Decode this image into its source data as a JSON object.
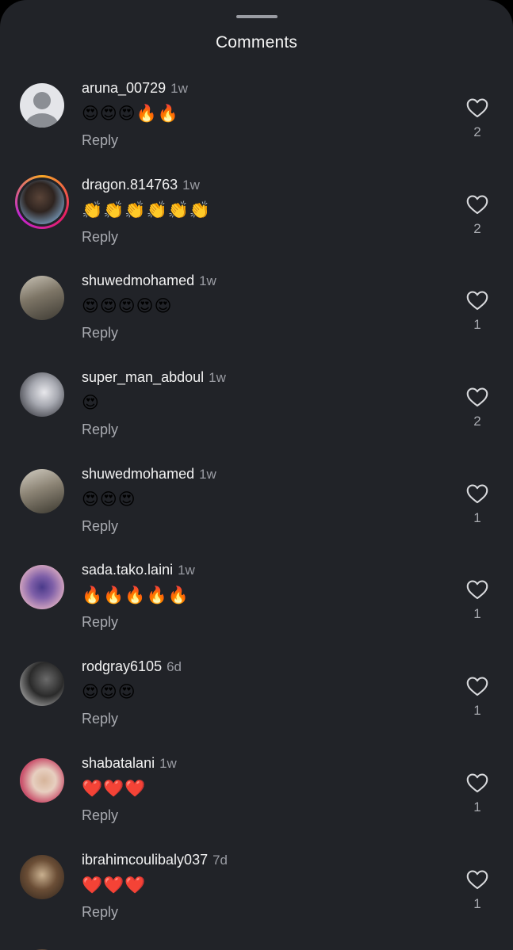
{
  "header": {
    "title": "Comments"
  },
  "comments": [
    {
      "username": "aruna_00729",
      "time": "1w",
      "text": "😍😍😍🔥🔥",
      "reply": "Reply",
      "likes": "2",
      "avatar": "default"
    },
    {
      "username": "dragon.814763",
      "time": "1w",
      "text": "👏👏👏👏👏👏",
      "reply": "Reply",
      "likes": "2",
      "avatar": "story"
    },
    {
      "username": "shuwedmohamed",
      "time": "1w",
      "text": "😍😍😍😍😍",
      "reply": "Reply",
      "likes": "1",
      "avatar": "photo"
    },
    {
      "username": "super_man_abdoul",
      "time": "1w",
      "text": "😍",
      "reply": "Reply",
      "likes": "2",
      "avatar": "photo"
    },
    {
      "username": "shuwedmohamed",
      "time": "1w",
      "text": "😍😍😍",
      "reply": "Reply",
      "likes": "1",
      "avatar": "photo"
    },
    {
      "username": "sada.tako.laini",
      "time": "1w",
      "text": "🔥🔥🔥🔥🔥",
      "reply": "Reply",
      "likes": "1",
      "avatar": "photo"
    },
    {
      "username": "rodgray6105",
      "time": "6d",
      "text": "😍😍😍",
      "reply": "Reply",
      "likes": "1",
      "avatar": "photo"
    },
    {
      "username": "shabatalani",
      "time": "1w",
      "text": "❤️❤️❤️",
      "reply": "Reply",
      "likes": "1",
      "avatar": "photo"
    },
    {
      "username": "ibrahimcoulibaly037",
      "time": "7d",
      "text": "❤️❤️❤️",
      "reply": "Reply",
      "likes": "1",
      "avatar": "photo"
    }
  ],
  "colors": {
    "background": "#212328",
    "text": "#f2f2f2",
    "muted": "#a9abb1"
  }
}
